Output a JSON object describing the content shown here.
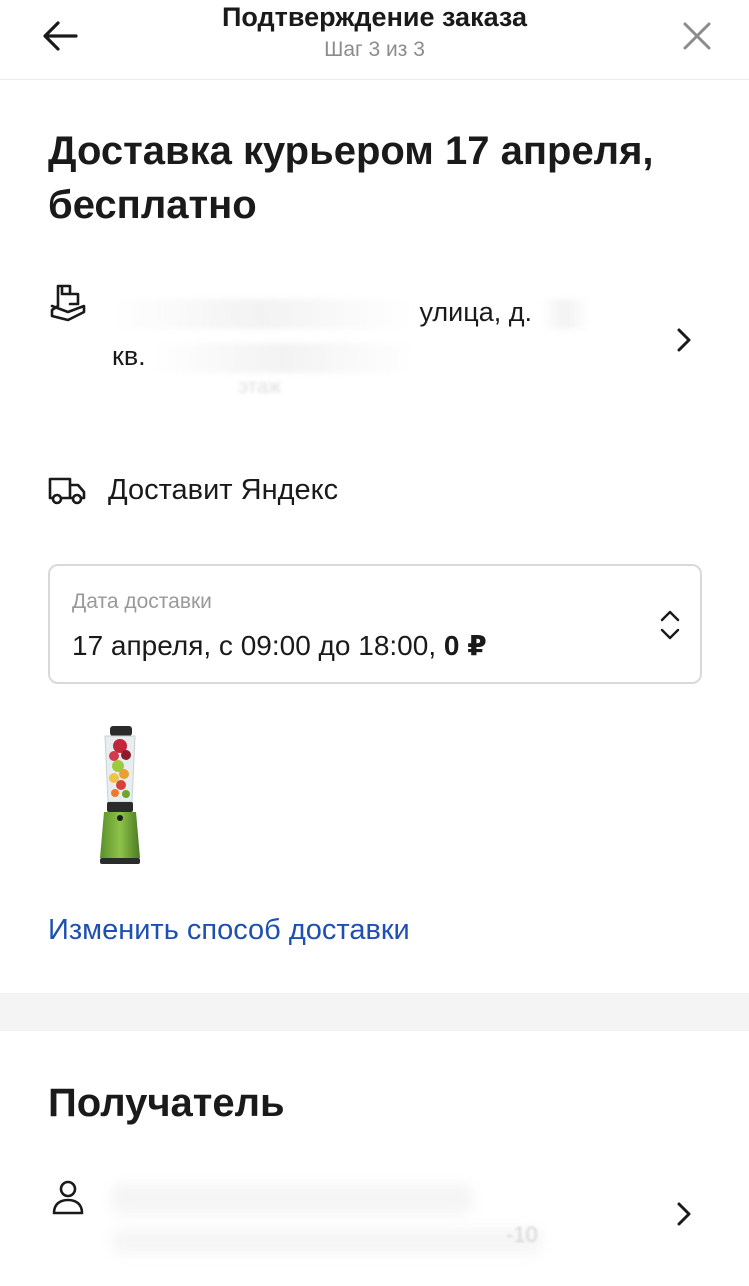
{
  "header": {
    "title": "Подтверждение заказа",
    "step": "Шаг 3 из 3"
  },
  "delivery": {
    "title": "Доставка курьером 17 апреля, бесплатно",
    "address_visible_fragment": "улица, д.",
    "address_line2_prefix": "кв.",
    "address_sub_fragment": "этаж",
    "courier": "Доставит Яндекс",
    "date_label": "Дата доставки",
    "date_value": "17 апреля, с 09:00 до 18:00,",
    "date_price": "0 ₽",
    "change_link": "Изменить способ доставки"
  },
  "recipient": {
    "title": "Получатель",
    "phone_tail_fragment": "-10"
  },
  "icons": {
    "back": "arrow-left-icon",
    "close": "close-icon",
    "address": "package-box-icon",
    "courier": "truck-icon",
    "select": "chevron-up-down-icon",
    "row_chevron": "chevron-right-icon",
    "recipient": "person-icon"
  },
  "colors": {
    "link": "#1e4fb3",
    "muted": "#8c8c8c",
    "divider": "#f4f4f4"
  }
}
